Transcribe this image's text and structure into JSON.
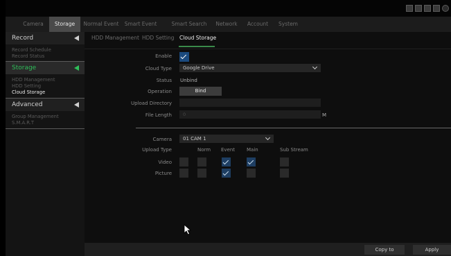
{
  "nav": {
    "tabs": [
      {
        "label": "Camera"
      },
      {
        "label": "Storage"
      },
      {
        "label": "Normal Event"
      },
      {
        "label": "Smart Event"
      },
      {
        "label": "Smart Search"
      },
      {
        "label": "Network"
      },
      {
        "label": "Account"
      },
      {
        "label": "System"
      }
    ],
    "active_tab": "Storage",
    "icons": [
      "monitor-icon",
      "user-icon",
      "grid-icon",
      "record-icon",
      "power-icon"
    ]
  },
  "sidebar": {
    "sections": [
      {
        "title": "Record",
        "items": [
          "Record Schedule",
          "Record Status"
        ]
      },
      {
        "title": "Storage",
        "items": [
          "HDD Management",
          "HDD Setting",
          "Cloud Storage"
        ]
      },
      {
        "title": "Advanced",
        "items": [
          "Group Management",
          "S.M.A.R.T"
        ]
      }
    ],
    "active_section": "Storage",
    "active_item": "Cloud Storage"
  },
  "subtabs": [
    "HDD Management",
    "HDD Setting",
    "Cloud Storage"
  ],
  "active_subtab": "Cloud Storage",
  "form": {
    "enable_label": "Enable",
    "enable_checked": true,
    "cloud_type_label": "Cloud Type",
    "cloud_type_value": "Google Drive",
    "status_label": "Status",
    "status_value": "Unbind",
    "operation_label": "Operation",
    "bind_button": "Bind",
    "upload_dir_label": "Upload Directory",
    "upload_dir_value": "",
    "file_length_label": "File Length",
    "file_length_value": "0",
    "file_length_unit": "M"
  },
  "camera_section": {
    "camera_label": "Camera",
    "camera_value": "01 CAM 1",
    "upload_type_label": "Upload Type",
    "columns": [
      "Norm",
      "Event",
      "Main",
      "Sub Stream"
    ],
    "rows": [
      {
        "label": "Video",
        "all": false,
        "norm": false,
        "event": true,
        "main": true,
        "sub_stream": false
      },
      {
        "label": "Picture",
        "all": false,
        "norm": false,
        "event": true,
        "main": false,
        "sub_stream": false
      }
    ]
  },
  "footer": {
    "copy_to": "Copy to",
    "apply": "Apply"
  },
  "colors": {
    "accent_green": "#2fbf5a",
    "check_blue": "#1e3e62",
    "background": "#0e0e0e"
  }
}
